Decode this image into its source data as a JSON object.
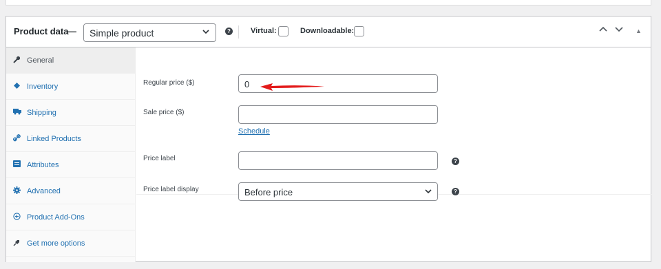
{
  "panel": {
    "title": "Product data",
    "dash": "—",
    "product_type": "Simple product",
    "virtual_label": "Virtual:",
    "downloadable_label": "Downloadable:",
    "help_glyph": "?",
    "controls": {
      "up": "^",
      "down": "v",
      "toggle": "▲"
    }
  },
  "tabs": [
    {
      "label": "General",
      "icon": "wrench-icon",
      "active": true
    },
    {
      "label": "Inventory",
      "icon": "tag-icon"
    },
    {
      "label": "Shipping",
      "icon": "truck-icon"
    },
    {
      "label": "Linked Products",
      "icon": "link-icon"
    },
    {
      "label": "Attributes",
      "icon": "list-icon"
    },
    {
      "label": "Advanced",
      "icon": "gear-icon"
    },
    {
      "label": "Product Add-Ons",
      "icon": "plus-circle-icon"
    },
    {
      "label": "Get more options",
      "icon": "plugin-icon"
    }
  ],
  "fields": {
    "regular_price": {
      "label": "Regular price ($)",
      "value": "0"
    },
    "sale_price": {
      "label": "Sale price ($)",
      "value": ""
    },
    "schedule_link": "Schedule",
    "price_label": {
      "label": "Price label",
      "value": ""
    },
    "price_label_display": {
      "label": "Price label display",
      "value": "Before price"
    }
  },
  "colors": {
    "accent": "#2271b1",
    "annotation_arrow": "#e31b1b",
    "border": "#c3c4c7"
  }
}
